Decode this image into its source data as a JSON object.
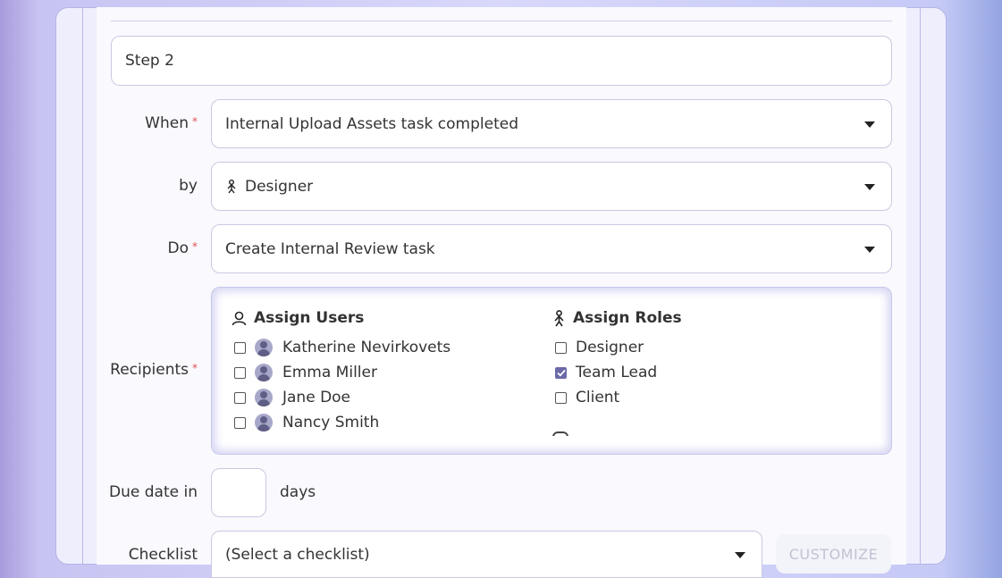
{
  "step_name": {
    "value": "Step 2"
  },
  "when": {
    "label": "When",
    "required": "*",
    "value": "Internal Upload Assets task completed"
  },
  "by": {
    "label": "by",
    "value": "Designer",
    "icon": "role-icon"
  },
  "do": {
    "label": "Do",
    "required": "*",
    "value": "Create Internal Review task"
  },
  "recipients": {
    "label": "Recipients",
    "required": "*",
    "users_heading": "Assign Users",
    "users": [
      {
        "name": "Katherine Nevirkovets",
        "checked": false
      },
      {
        "name": "Emma Miller",
        "checked": false
      },
      {
        "name": "Jane Doe",
        "checked": false
      },
      {
        "name": "Nancy Smith",
        "checked": false
      }
    ],
    "roles_heading": "Assign Roles",
    "roles": [
      {
        "name": "Designer",
        "checked": false
      },
      {
        "name": "Team Lead",
        "checked": true
      },
      {
        "name": "Client",
        "checked": false
      }
    ]
  },
  "due_date": {
    "label": "Due date in",
    "value": "",
    "suffix": "days"
  },
  "checklist": {
    "label": "Checklist",
    "value": "(Select a checklist)",
    "customize_label": "CUSTOMIZE"
  }
}
